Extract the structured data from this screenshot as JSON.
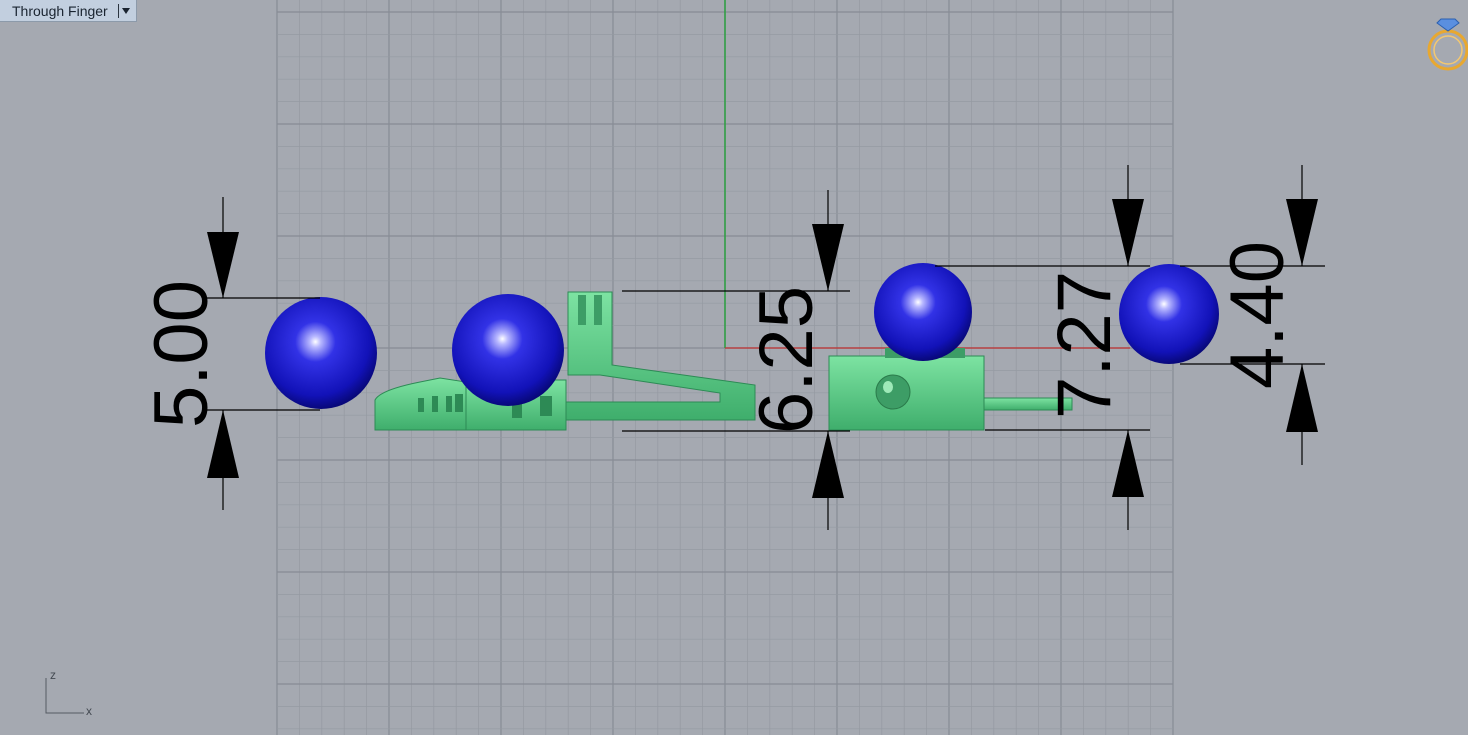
{
  "viewport": {
    "name": "Through Finger",
    "menu_icon": "chevron-down-icon"
  },
  "dimensions": [
    {
      "id": "dim-left",
      "value": "5.00"
    },
    {
      "id": "dim-middle",
      "value": "6.25"
    },
    {
      "id": "dim-right-1",
      "value": "7.27"
    },
    {
      "id": "dim-right-2",
      "value": "4.40"
    }
  ],
  "axes": {
    "z_label": "z",
    "x_label": "x"
  },
  "icons": {
    "ring_widget": "ring-gem-icon"
  },
  "colors": {
    "background": "#a5a9b1",
    "grid": "#959aa2",
    "grid_major": "#878c95",
    "sphere": "#1a1acc",
    "part": "#5ed98a",
    "axis_x": "#c03030",
    "axis_y": "#2aa040",
    "ring_icon": "#e8a830"
  }
}
